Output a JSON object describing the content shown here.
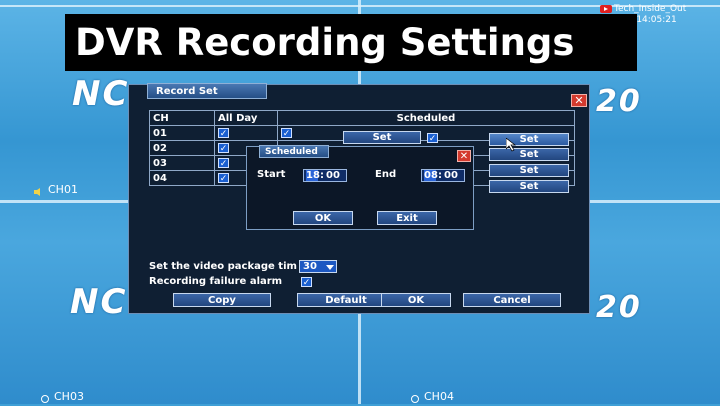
{
  "banner": {
    "title": "DVR Recording Settings"
  },
  "watermark": {
    "channel": "Tech_Inside_Out",
    "time": "26 14:05:21"
  },
  "background": {
    "logo_text": "NC",
    "logo_suffix": "20",
    "ch01": "CH01",
    "ch03": "CH03",
    "ch04": "CH04"
  },
  "record_set": {
    "title": "Record Set",
    "headers": {
      "ch": "CH",
      "all_day": "All Day",
      "scheduled": "Scheduled"
    },
    "rows": [
      {
        "ch": "01",
        "set_mid": "Set",
        "set_right": "Set"
      },
      {
        "ch": "02",
        "set_right": "Set"
      },
      {
        "ch": "03",
        "set_right": "Set"
      },
      {
        "ch": "04",
        "set_right": "Set"
      }
    ],
    "package_label": "Set the video package tim",
    "package_value": "30",
    "alarm_label": "Recording failure alarm",
    "buttons": {
      "copy": "Copy",
      "default": "Default",
      "ok": "OK",
      "cancel": "Cancel"
    }
  },
  "scheduled_dialog": {
    "title": "Scheduled",
    "start_label": "Start",
    "start_h": "18",
    "start_m": "00",
    "end_label": "End",
    "end_h": "08",
    "end_m": "00",
    "sep": ":",
    "ok": "OK",
    "exit": "Exit"
  },
  "check_mark": "✓",
  "close_mark": "✕"
}
